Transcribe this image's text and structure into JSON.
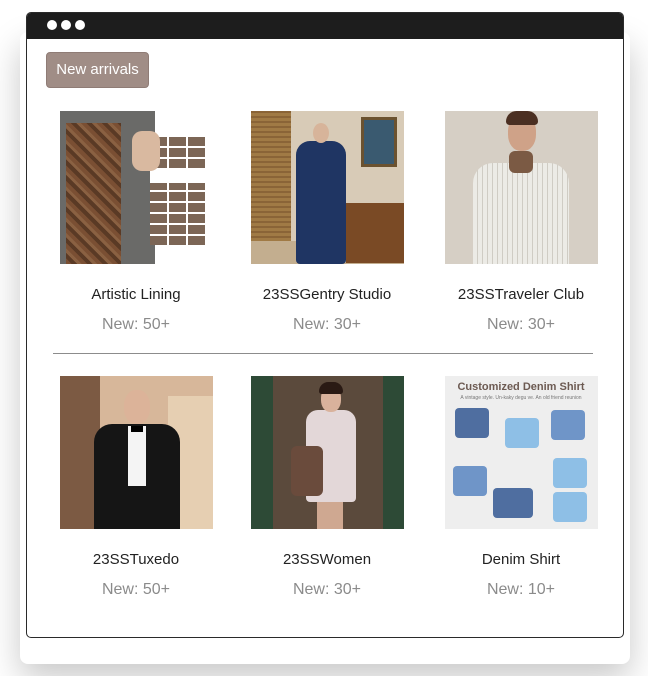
{
  "header": {
    "new_arrivals_label": "New arrivals"
  },
  "collections": [
    {
      "name": "Artistic Lining",
      "count": "New: 50+"
    },
    {
      "name": "23SSGentry Studio",
      "count": "New: 30+"
    },
    {
      "name": "23SSTraveler Club",
      "count": "New: 30+"
    },
    {
      "name": "23SSTuxedo",
      "count": "New: 50+"
    },
    {
      "name": "23SSWomen",
      "count": "New: 30+"
    },
    {
      "name": "Denim Shirt",
      "count": "New: 10+"
    }
  ],
  "denim_thumb": {
    "title": "Customized Denim Shirt",
    "subtitle": "A vintage style. Un-kaky degu ve. An old friend reunion"
  },
  "colors": {
    "accent": "#a08d86",
    "titlebar": "#1d1d1d",
    "count_text": "#8b8b8b"
  }
}
